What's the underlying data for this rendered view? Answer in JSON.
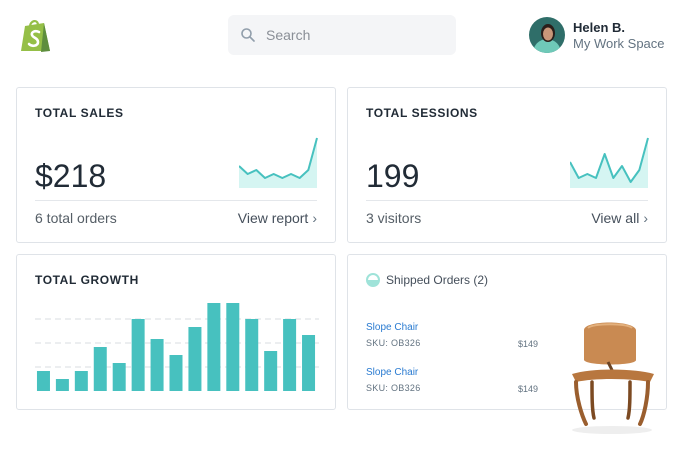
{
  "header": {
    "logo_icon": "shopify-bag-icon",
    "search_placeholder": "Search",
    "user": {
      "name": "Helen B.",
      "workspace": "My Work Space"
    }
  },
  "colors": {
    "accent": "#47c1bf",
    "accent_light": "#d5f5f2",
    "brand": "#95bf47"
  },
  "sales": {
    "title": "TOTAL SALES",
    "value": "$218",
    "subtext": "6 total orders",
    "link": "View report"
  },
  "sessions": {
    "title": "TOTAL SESSIONS",
    "value": "199",
    "subtext": "3 visitors",
    "link": "View all"
  },
  "growth": {
    "title": "TOTAL GROWTH"
  },
  "shipped": {
    "title": "Shipped Orders (2)",
    "orders": [
      {
        "name": "Slope Chair",
        "sku": "SKU: OB326",
        "price": "$149"
      },
      {
        "name": "Slope Chair",
        "sku": "SKU: OB326",
        "price": "$149"
      }
    ]
  },
  "chart_data": [
    {
      "type": "line",
      "series": [
        {
          "values": [
            5,
            3,
            4,
            2,
            3,
            2,
            3,
            2,
            4,
            12
          ]
        }
      ]
    },
    {
      "type": "line",
      "series": [
        {
          "values": [
            6,
            2,
            3,
            2,
            8,
            2,
            5,
            1,
            4,
            12
          ]
        }
      ]
    },
    {
      "type": "bar",
      "series": [
        {
          "values": [
            5,
            3,
            5,
            11,
            7,
            18,
            13,
            9,
            16,
            22,
            22,
            18,
            10,
            18,
            14
          ]
        }
      ],
      "ylim": [
        0,
        24
      ],
      "grid": true
    }
  ]
}
